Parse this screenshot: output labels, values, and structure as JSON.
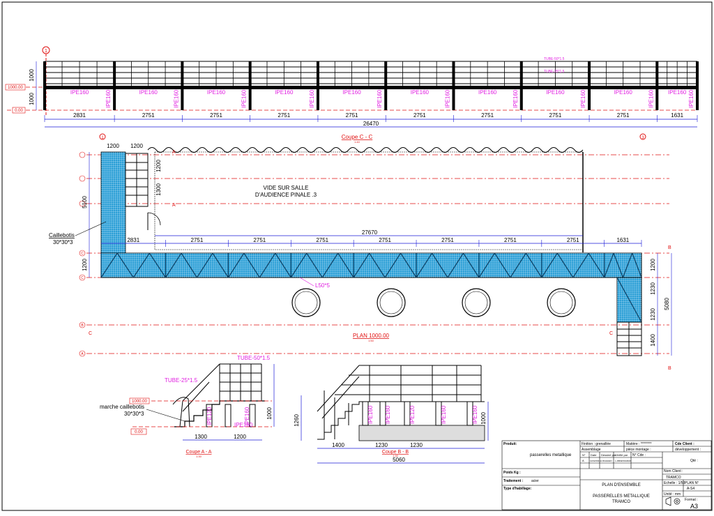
{
  "elevation": {
    "levels": [
      "1000.00",
      "0.00"
    ],
    "heights": [
      "1000",
      "1000"
    ],
    "beam_label": "IPE160",
    "tubes": [
      "TUBE-50*1.5",
      "TUBE-25*1.5"
    ],
    "spans": [
      "2831",
      "2751",
      "2751",
      "2751",
      "2751",
      "2751",
      "2751",
      "2751",
      "2751",
      "1631"
    ],
    "total": "26470",
    "grid_marker": "1"
  },
  "plan": {
    "title": "Coupe C - C",
    "title_scale": "1:40",
    "grid_markers": [
      "1",
      "3"
    ],
    "axis_labels": [
      "C",
      "C",
      "B",
      "B",
      "A"
    ],
    "section_marks": [
      "A",
      "A",
      "B",
      "B",
      "C",
      "C"
    ],
    "void_label_line1": "VIDE SUR SALLE",
    "void_label_line2": "D'AUDIENCE PINALE .3",
    "overall_width": "27670",
    "spans": [
      "2831",
      "2751",
      "2751",
      "2751",
      "2751",
      "2751",
      "2751",
      "2751",
      "1631"
    ],
    "left_dims": [
      "1200",
      "5100",
      "1200"
    ],
    "stair_dims": [
      "1200",
      "1200",
      "1300"
    ],
    "right_dims": [
      "1200",
      "1230",
      "1230",
      "1400",
      "5080"
    ],
    "caillebotis_label": "Caillebotis",
    "caillebotis_size": "30*30*3",
    "angle_label": "L50*5",
    "plan_level": "PLAN 1000.00",
    "plan_level_scale": "1:50"
  },
  "section_a": {
    "title": "Coupe A - A",
    "scale": "1:30",
    "tube_top": "TUBE-50*1.5",
    "tube_rail": "TUBE-25*1.5",
    "step_label": "marche caillebotis",
    "step_size": "30*30*3",
    "level_top": "1000.00",
    "level_bottom": "0.00",
    "beams": [
      "IPE120",
      "IPE160",
      "IPE160"
    ],
    "dims_bottom": [
      "1300",
      "1200"
    ],
    "dim_height": "1000"
  },
  "section_b": {
    "title": "Coupe B - B",
    "scale": "1:30",
    "beams": [
      "IPE160",
      "IPE160",
      "IPE120",
      "IPE160",
      "IPE160"
    ],
    "dims_bottom": [
      "1400",
      "1230",
      "1230"
    ],
    "total": "5060",
    "dim_left": "1260",
    "dim_right": "1000"
  },
  "title_block": {
    "produit_label": "Produit:",
    "produit_value": "passerelles metallique",
    "poids_label": "Poids Kg :",
    "traitement_label": "Traitement :",
    "traitement_value": "acier",
    "habillage_label": "Type d'habillage:",
    "finition_label": "Finition : grenaillée",
    "matiere_label": "Matière : ********",
    "client_code_label": "Cde Client :",
    "assemblage_label": "Assemblage",
    "piece_montage_label": "pièce montage :",
    "developpement_label": "développement :",
    "rev_headers": [
      "N°",
      "Date",
      "Dessiné par",
      "Vérifié par"
    ],
    "rev_row": [
      "A",
      "12/02/2021",
      "H.RIAHHEN",
      "L.ABDESSAMAD"
    ],
    "cde_label": "N° Cde :",
    "qte_label": "Qté :",
    "nom_client_label": "Nom Client :",
    "nom_client_value": "TRAMCO",
    "drawing_title1": "PLAN D'ENSEMBLE",
    "drawing_title2": "PASSERELLES METALLIQUE",
    "drawing_title3": "TRAMCO",
    "echelle_label": "Echelle : 1/50",
    "plan_no_label": "PLAN N°",
    "plan_no_value": "A-S4",
    "unite_label": "Unité : mm",
    "format_label": "Format :",
    "format_value": "A3"
  }
}
